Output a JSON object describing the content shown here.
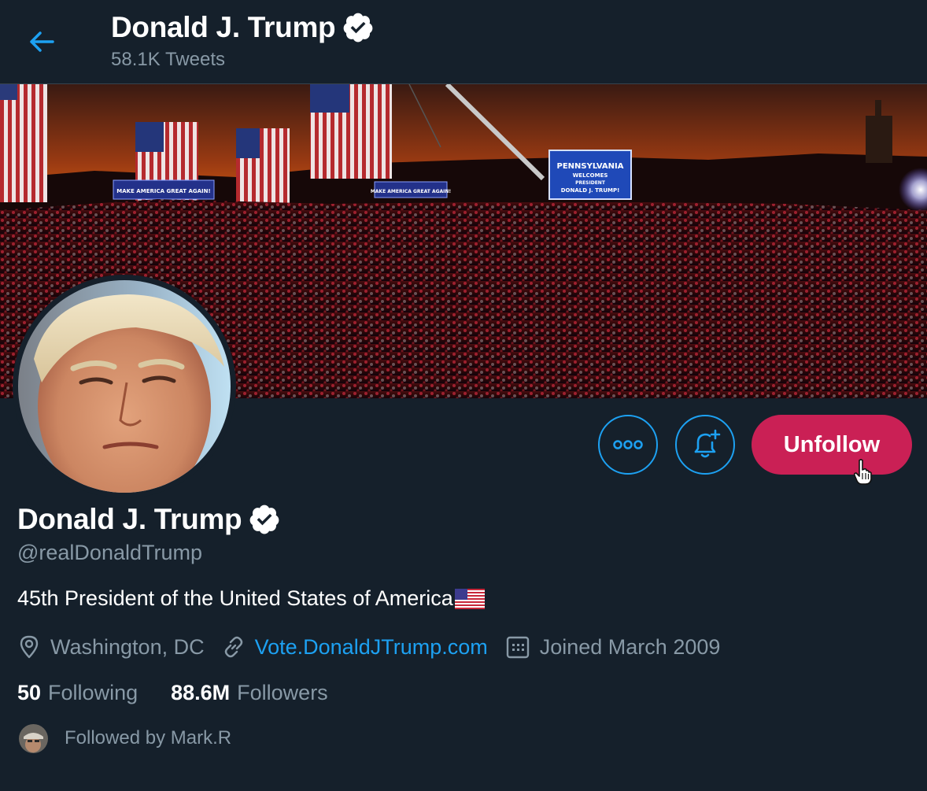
{
  "header": {
    "name": "Donald J. Trump",
    "tweet_count": "58.1K Tweets"
  },
  "banner": {
    "screen_lines": [
      "PENNSYLVANIA",
      "WELCOMES",
      "PRESIDENT",
      "DONALD J. TRUMP!"
    ],
    "sign_left": "MAKE AMERICA GREAT AGAIN!",
    "sign_center": "MAKE AMERICA GREAT AGAIN!"
  },
  "actions": {
    "unfollow_label": "Unfollow"
  },
  "profile": {
    "name": "Donald J. Trump",
    "handle": "@realDonaldTrump",
    "bio": "45th President of the United States of America",
    "location": "Washington, DC",
    "website": "Vote.DonaldJTrump.com",
    "joined": "Joined March 2009"
  },
  "stats": {
    "following_count": "50",
    "following_label": "Following",
    "followers_count": "88.6M",
    "followers_label": "Followers"
  },
  "followed_by": "Followed by Mark.R",
  "colors": {
    "background": "#15202b",
    "accent": "#1da1f2",
    "unfollow": "#ca2055",
    "secondary_text": "#8899a6"
  },
  "icons": {
    "back": "arrow-left-icon",
    "verified": "verified-badge-icon",
    "more": "more-dots-icon",
    "notify": "bell-plus-icon",
    "location": "location-pin-icon",
    "website": "link-icon",
    "joined": "calendar-icon",
    "flag": "us-flag-icon"
  }
}
